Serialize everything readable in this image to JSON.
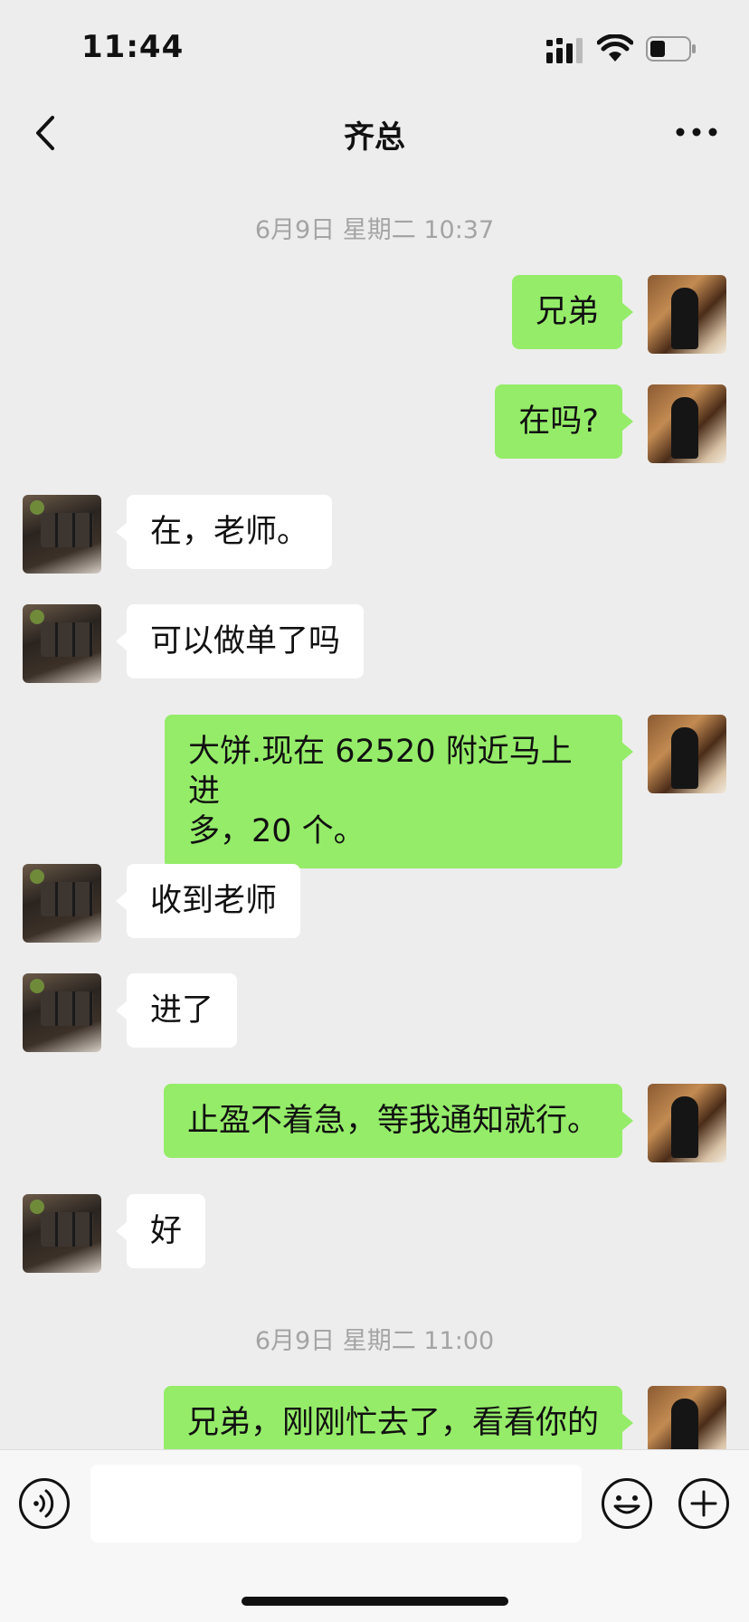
{
  "status_bar": {
    "time": "11:44",
    "icons": [
      "cellular-signal-icon",
      "wifi-icon",
      "battery-icon"
    ],
    "battery_level": 0.35
  },
  "nav": {
    "title": "齐总",
    "back_icon": "chevron-left-icon",
    "more_icon": "more-dots-icon"
  },
  "chat": {
    "timestamps": [
      "6月9日 星期二 10:37",
      "6月9日 星期二 11:00"
    ],
    "messages": [
      {
        "sender": "me",
        "text": "兄弟"
      },
      {
        "sender": "me",
        "text": "在吗?"
      },
      {
        "sender": "other",
        "text": "在，老师。"
      },
      {
        "sender": "other",
        "text": "可以做单了吗"
      },
      {
        "sender": "me",
        "line1": "大饼.现在 62520 附近马上进",
        "line2": "多，20 个。"
      },
      {
        "sender": "other",
        "text": "收到老师"
      },
      {
        "sender": "other",
        "text": "进了"
      },
      {
        "sender": "me",
        "text": "止盈不着急，等我通知就行。"
      },
      {
        "sender": "other",
        "text": "好"
      },
      {
        "sender": "me",
        "text": "兄弟，刚刚忙去了，看看你的"
      }
    ]
  },
  "input_bar": {
    "voice_icon": "voice-icon",
    "text_value": "",
    "emoji_icon": "emoji-icon",
    "plus_icon": "plus-icon"
  },
  "colors": {
    "background": "#ededed",
    "my_bubble": "#95ec69",
    "other_bubble": "#ffffff",
    "timestamp_text": "#a4a4a4"
  }
}
